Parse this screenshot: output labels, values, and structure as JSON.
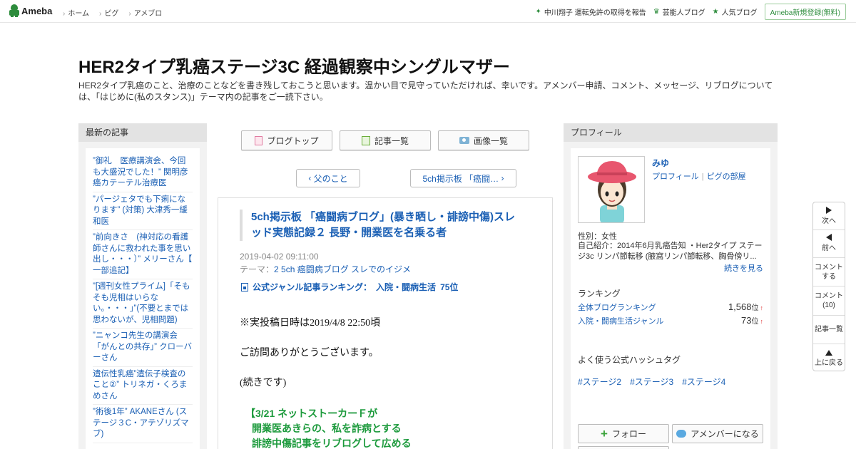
{
  "topbar": {
    "logo": "Ameba",
    "nav": [
      "ホーム",
      "ピグ",
      "アメブロ"
    ],
    "news": "中川翔子 運転免許の取得を報告",
    "celebrity": "芸能人ブログ",
    "popular": "人気ブログ",
    "register": "Ameba新規登録(無料)"
  },
  "header": {
    "title": "HER2タイプ乳癌ステージ3C 経過観察中シングルマザー",
    "description": "HER2タイプ乳癌のこと、治療のことなどを書き残しておこうと思います。温かい目で見守っていただければ、幸いです。アメンバー申請、コメント、メッセージ、リブログについては、「はじめに(私のスタンス)」テーマ内の記事をご一読下さい。"
  },
  "left": {
    "heading": "最新の記事",
    "items": [
      "”御礼　医療講演会、今回も大盛況でした！” 関明彦 癌カテーテル治療医",
      "”パージェタでも下痢になります” (対策) 大津秀一緩和医",
      "”前向きさ　(神対応の看護師さんに救われた事を思い出し・・・）” メリーさん【 一部追記】",
      "”[週刊女性プライム]「そもそも児相はいらない。・・・」”(不要とまでは思わないが、児相問題)",
      "”ニャンコ先生の講演会「がんとの共存」” クローバーさん",
      "遺伝性乳癌”遺伝子検査のこと②” トリネガ・くろまめさん",
      "”術後1年” AKANEさん (ステージ３C・アテゾリズマブ)"
    ]
  },
  "center": {
    "blog_top": "ブログトップ",
    "article_list": "記事一覧",
    "image_list": "画像一覧",
    "prev": "父のこと",
    "next": "5ch掲示板 「癌闘…",
    "article": {
      "title": "5ch掲示板 「癌闘病ブログ」(暴き晒し・誹謗中傷)スレッド実態記録２ 長野・開業医を名乗る者",
      "date": "2019-04-02 09:11:00",
      "theme_label": "テーマ：",
      "theme": "2 5ch 癌闘病ブログ スレでのイジメ",
      "ranking_label": "公式ジャンル記事ランキング：",
      "ranking_genre": "入院・闘病生活",
      "ranking_value": "75位",
      "body": [
        "※実投稿日時は2019/4/8  22:50頃",
        "ご訪問ありがとうございます。",
        "(続きです)"
      ],
      "green_lines": [
        "【3/21  ネットストーカーＦが",
        "開業医あきらの、私を詐病とする",
        "誹謗中傷記事をリブログして広める"
      ]
    }
  },
  "right": {
    "heading": "プロフィール",
    "name": "みゆ",
    "profile_link": "プロフィール",
    "pigg_link": "ピグの部屋",
    "gender": "性別：女性",
    "intro": "自己紹介：2014年6月乳癌告知 ・Her2タイプ ステージ3c リンパ節転移 (腋窩リンパ節転移、胸骨傍リ...",
    "more": "続きを見る",
    "ranking_heading": "ランキング",
    "rankings": [
      {
        "label": "全体ブログランキング",
        "value": "1,568",
        "unit": "位",
        "trend": "↑"
      },
      {
        "label": "入院・闘病生活ジャンル",
        "value": "73",
        "unit": "位",
        "trend": "↑"
      }
    ],
    "hashtag_heading": "よく使う公式ハッシュタグ",
    "hashtags": [
      "#ステージ2",
      "#ステージ3",
      "#ステージ4"
    ],
    "follow": "フォロー",
    "amember": "アメンバーになる"
  },
  "sidenav": {
    "next": "次へ",
    "prev": "前へ",
    "comment_do": [
      "コメント",
      "する"
    ],
    "comment_count": [
      "コメント",
      "(10)"
    ],
    "article_list": "記事一覧",
    "top": "上に戻る"
  }
}
